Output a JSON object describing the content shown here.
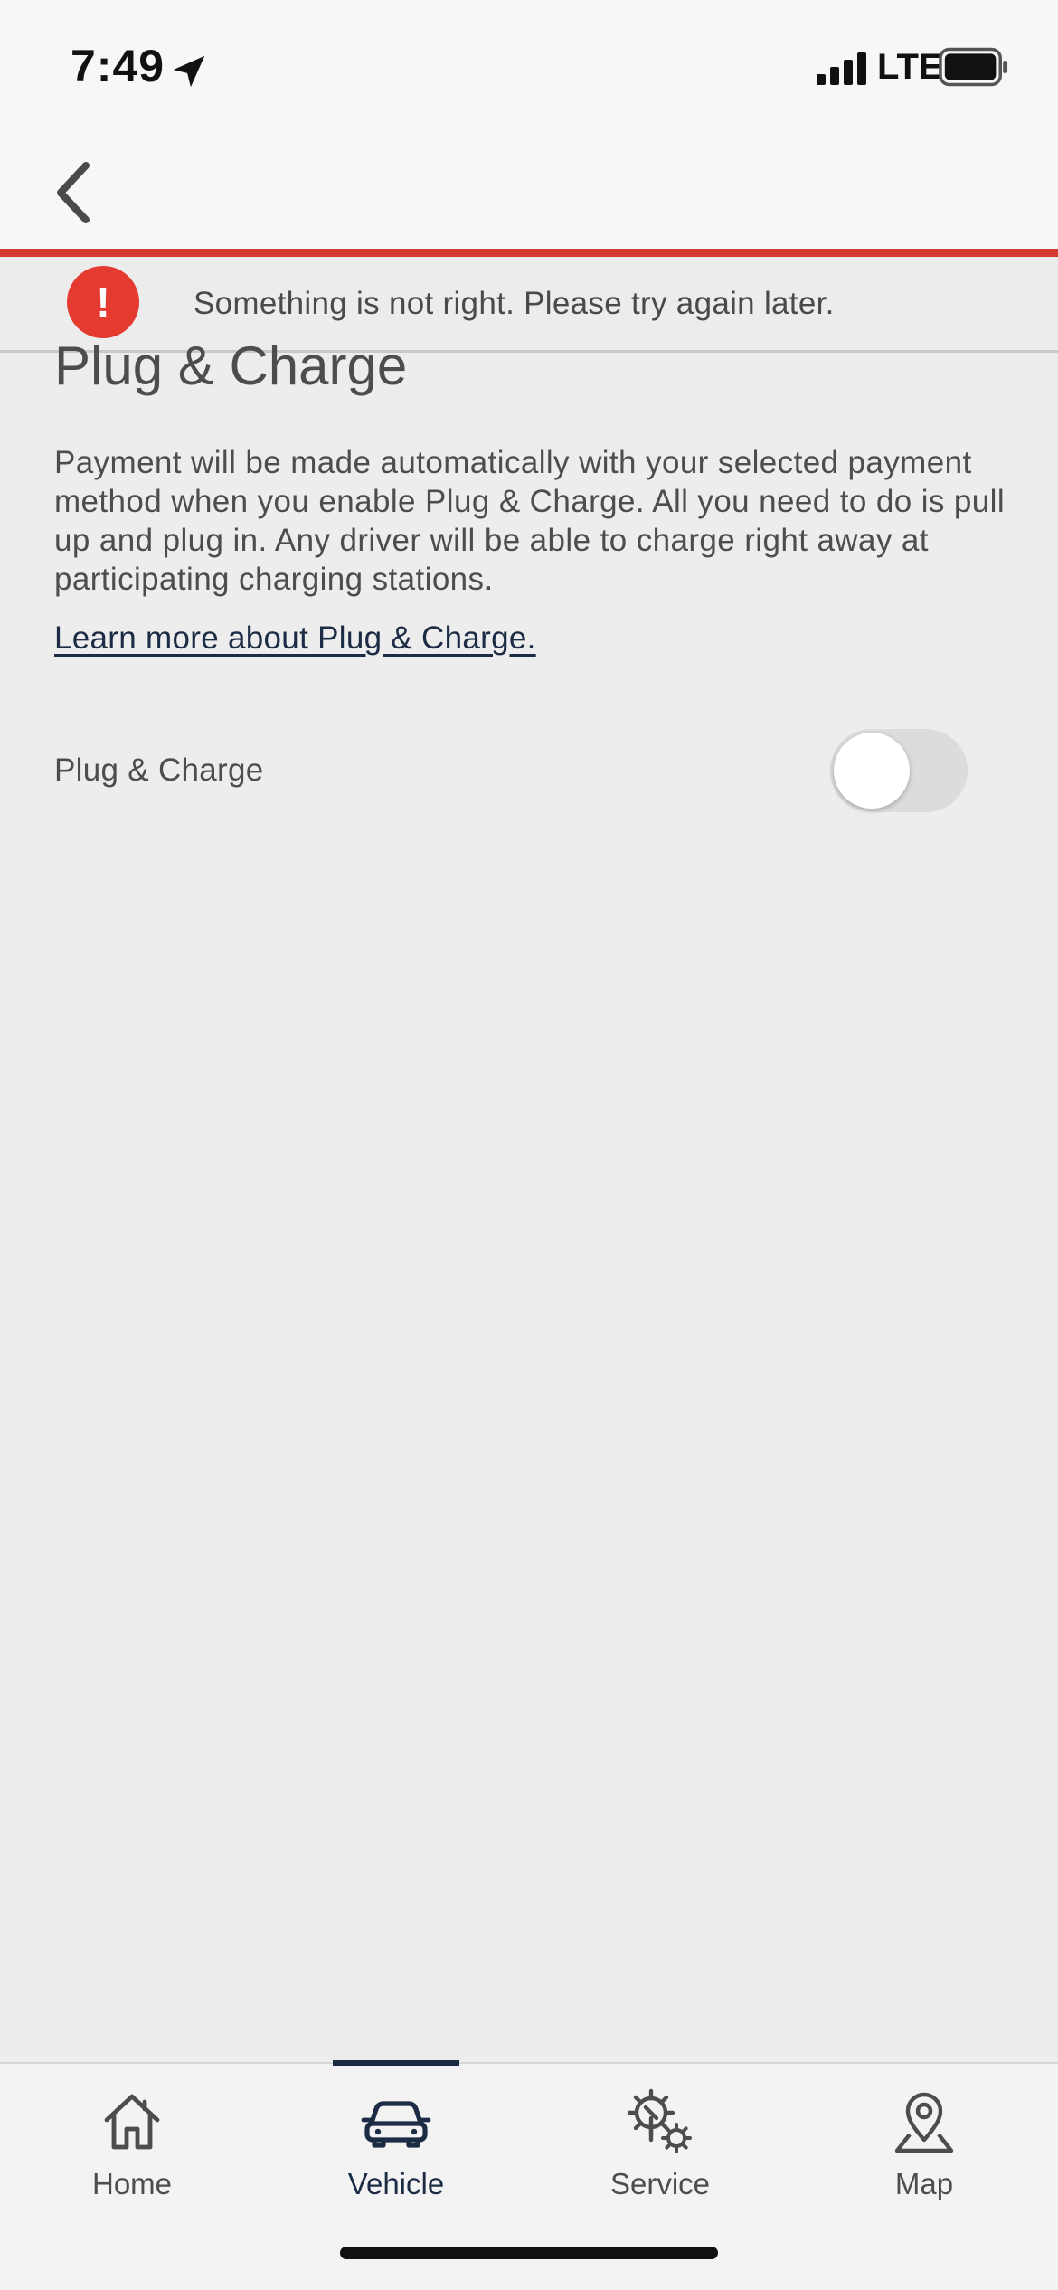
{
  "status_bar": {
    "time": "7:49",
    "network": "LTE",
    "icons": [
      "location-arrow-icon",
      "cellular-signal-icon",
      "battery-icon"
    ]
  },
  "nav": {
    "back_icon": "chevron-left-icon"
  },
  "error_banner": {
    "icon": "exclamation-icon",
    "icon_glyph": "!",
    "message": "Something is not right. Please try again later.",
    "accent_color": "#d23b2f"
  },
  "content": {
    "title": "Plug & Charge",
    "description": "Payment will be made automatically with your selected payment method when you enable Plug & Charge. All you need to do is pull up and plug in. Any driver will be able to charge right away at participating charging stations.",
    "learn_more_link": "Learn more about Plug & Charge.",
    "setting": {
      "label": "Plug & Charge",
      "enabled": false
    }
  },
  "tab_bar": {
    "active_color": "#1d2c45",
    "tabs": [
      {
        "label": "Home",
        "icon": "home-icon",
        "active": false
      },
      {
        "label": "Vehicle",
        "icon": "car-icon",
        "active": true
      },
      {
        "label": "Service",
        "icon": "service-gears-icon",
        "active": false
      },
      {
        "label": "Map",
        "icon": "map-pin-icon",
        "active": false
      }
    ]
  }
}
